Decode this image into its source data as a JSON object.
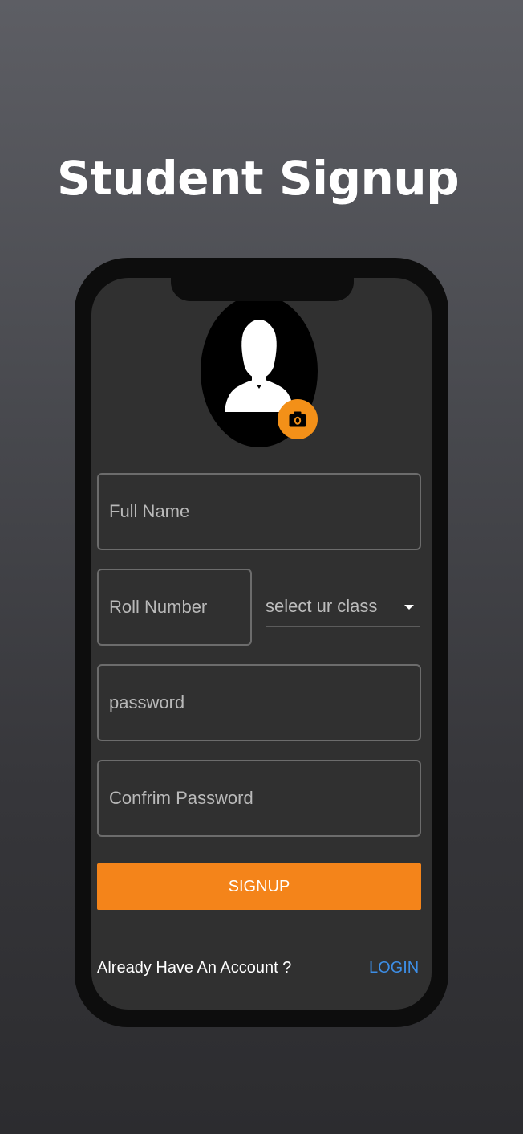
{
  "page": {
    "title": "Student Signup"
  },
  "form": {
    "full_name_placeholder": "Full Name",
    "roll_number_placeholder": "Roll Number",
    "class_select_label": "select ur class",
    "password_placeholder": "password",
    "confirm_password_placeholder": "Confrim Password",
    "signup_label": "SIGNUP"
  },
  "footer": {
    "already_text": "Already Have An Account ?",
    "login_label": "LOGIN"
  },
  "icons": {
    "avatar": "user-silhouette-icon",
    "camera": "camera-icon",
    "dropdown": "caret-down-icon"
  },
  "colors": {
    "accent": "#f4841a",
    "link": "#3d8ee6",
    "screen_bg": "#303030",
    "phone_frame": "#0d0d0d"
  }
}
